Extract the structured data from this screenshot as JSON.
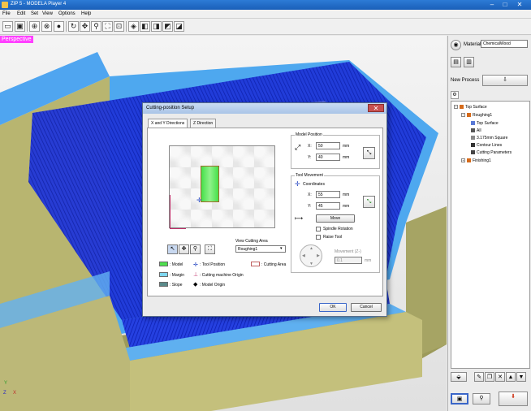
{
  "window": {
    "title": "ZIP 5 - MODELA Player 4",
    "minimize": "–",
    "maximize": "□",
    "close": "✕"
  },
  "menu": [
    "File",
    "Edit",
    "Set",
    "View",
    "Options",
    "Help"
  ],
  "toolbar_icons": [
    "new-file-icon",
    "open-file-icon",
    "save-icon",
    "world-icon",
    "globe-icon",
    "sphere-icon",
    "rotate-icon",
    "pan-icon",
    "zoom-icon",
    "fit-all-icon",
    "fit-model-icon",
    "view-iso-icon",
    "view-front-icon",
    "view-top-icon",
    "view-right-icon",
    "view-bottom-icon"
  ],
  "viewport": {
    "tag": "Perspective"
  },
  "right_panel": {
    "material_label": "Material",
    "material_value": "ChemicalWood",
    "new_process_label": "New Process",
    "tree": [
      {
        "label": "Top Surface",
        "level": 0
      },
      {
        "label": "Roughing1",
        "level": 1
      },
      {
        "label": "Top Surface",
        "level": 2
      },
      {
        "label": "All",
        "level": 2
      },
      {
        "label": "3.175mm Square",
        "level": 2
      },
      {
        "label": "Contour Lines",
        "level": 2
      },
      {
        "label": "Cutting Parameters",
        "level": 2
      },
      {
        "label": "Finishing1",
        "level": 1
      }
    ]
  },
  "dialog": {
    "title": "Cutting-position Setup",
    "tabs": [
      "X and Y Directions",
      "Z Direction"
    ],
    "model_position": {
      "title": "Model Position",
      "x_label": "X:",
      "x_value": "50",
      "y_label": "Y:",
      "y_value": "40",
      "unit": "mm"
    },
    "tool_movement": {
      "title": "Tool Movement",
      "coordinates_label": "Coordinates",
      "x_label": "X:",
      "x_value": "55",
      "y_label": "Y:",
      "y_value": "45",
      "unit": "mm",
      "move_label": "Move",
      "spindle_rotation": "Spindle Rotation",
      "raise_tool": "Raise Tool",
      "movement_label": "Movement (Z-)",
      "movement_value": "0.1",
      "movement_unit": "mm"
    },
    "view_cutting_area_label": "View Cutting Area",
    "view_cutting_area_value": "Roughing1",
    "legend": [
      {
        "label": ": Model",
        "color": "#4fe04f"
      },
      {
        "label": ": Tool Position",
        "color": ""
      },
      {
        "label": ": Cutting Area",
        "color": "#ffffff"
      },
      {
        "label": ": Margin",
        "color": "#7fd7f0"
      },
      {
        "label": ": Cutting machine Origin",
        "color": ""
      },
      {
        "label": ": Slope",
        "color": "#5a8a8a"
      },
      {
        "label": ": Model Origin",
        "color": ""
      }
    ],
    "ok": "OK",
    "cancel": "Cancel"
  }
}
